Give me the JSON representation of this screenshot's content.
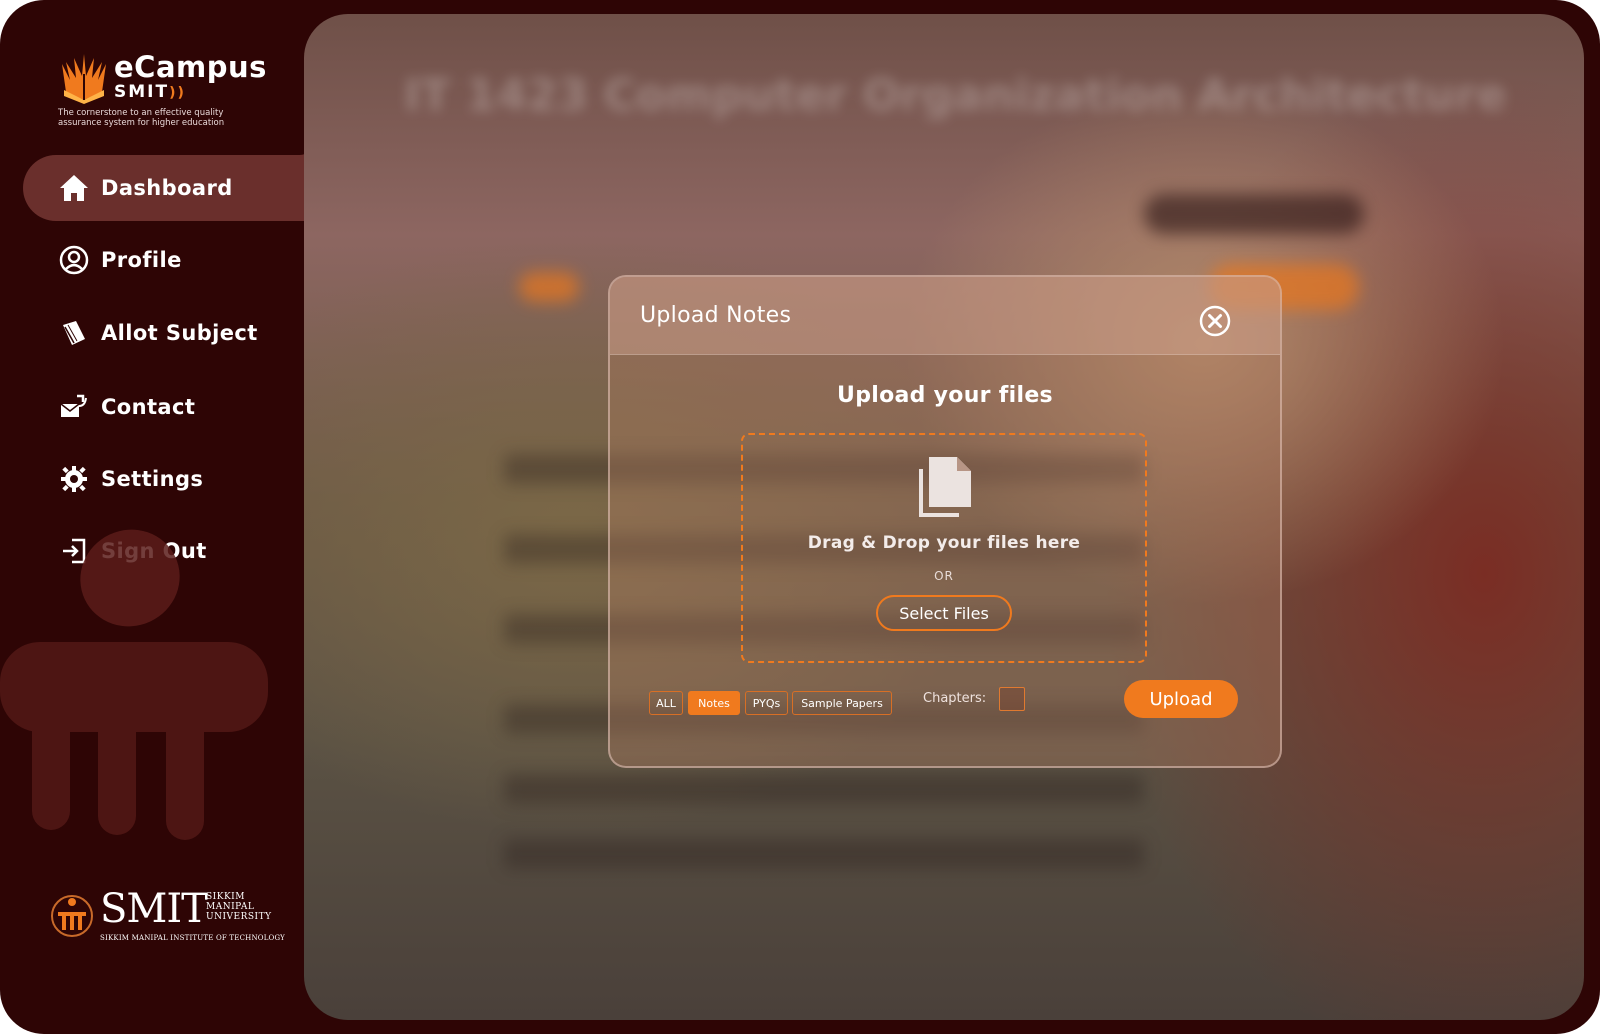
{
  "brand": {
    "title": "eCampus",
    "subtitle": "SMIT",
    "tagline": "The cornerstone to an effective quality assurance system for higher education"
  },
  "sidebar": {
    "items": [
      {
        "label": "Dashboard",
        "icon": "home-icon",
        "active": true
      },
      {
        "label": "Profile",
        "icon": "user-circle-icon",
        "active": false
      },
      {
        "label": "Allot Subject",
        "icon": "book-icon",
        "active": false
      },
      {
        "label": "Contact",
        "icon": "contact-mail-icon",
        "active": false
      },
      {
        "label": "Settings",
        "icon": "gear-icon",
        "active": false
      },
      {
        "label": "Sign Out",
        "icon": "sign-out-icon",
        "active": false
      }
    ]
  },
  "footer_logo": {
    "name": "SMIT",
    "side_line1": "SIKKIM",
    "side_line2": "MANIPAL",
    "side_line3": "UNIVERSITY",
    "full_name": "SIKKIM MANIPAL INSTITUTE OF TECHNOLOGY"
  },
  "background": {
    "title": "IT 1423 Computer Organization Architecture"
  },
  "modal": {
    "title": "Upload Notes",
    "heading": "Upload your files",
    "drag_text": "Drag & Drop your files here",
    "or_text": "OR",
    "select_label": "Select Files",
    "filters": [
      {
        "label": "ALL",
        "selected": false
      },
      {
        "label": "Notes",
        "selected": true
      },
      {
        "label": "PYQs",
        "selected": false
      },
      {
        "label": "Sample Papers",
        "selected": false
      }
    ],
    "chapters_label": "Chapters:",
    "chapters_value": "",
    "upload_label": "Upload"
  },
  "colors": {
    "accent": "#f07a1e",
    "sidebar_bg": "#2e0505",
    "active_item_bg": "#6a2f2c"
  }
}
